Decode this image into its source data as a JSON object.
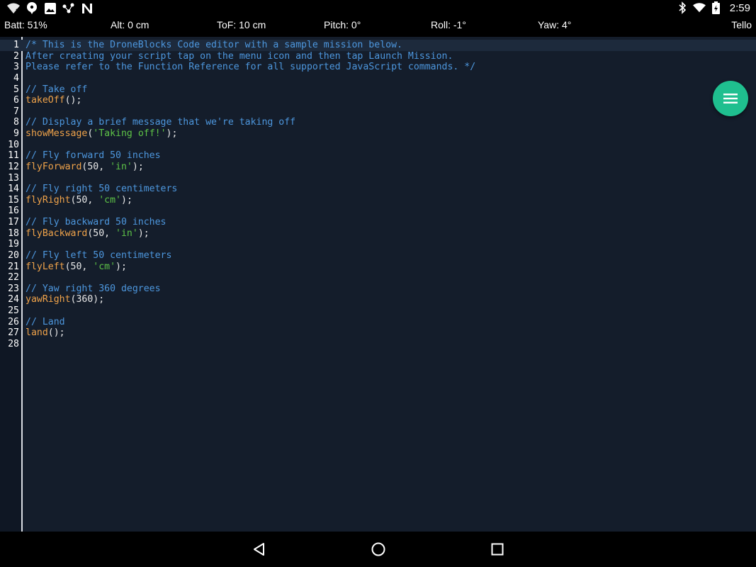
{
  "status_bar": {
    "left_icons": [
      "wifi-question-icon",
      "chat-bubble-icon",
      "image-icon",
      "dots-connect-icon",
      "n-logo-icon"
    ],
    "right_icons": [
      "bluetooth-icon",
      "wifi-icon",
      "battery-icon"
    ],
    "time": "2:59"
  },
  "telemetry": {
    "battery": "Batt: 51%",
    "altitude": "Alt: 0 cm",
    "tof": "ToF: 10 cm",
    "pitch": "Pitch: 0°",
    "roll": "Roll: -1°",
    "yaw": "Yaw: 4°",
    "drone": "Tello"
  },
  "colors": {
    "editor_bg": "#141d2b",
    "comment": "#4d97de",
    "function": "#f0a34a",
    "string": "#5ec447",
    "fab": "#1fbf8f"
  },
  "editor": {
    "active_line": 1,
    "lines": [
      {
        "n": "1",
        "tokens": [
          [
            "c",
            "/* This is the DroneBlocks Code editor with a sample mission below."
          ]
        ]
      },
      {
        "n": "2",
        "tokens": [
          [
            "c",
            "After creating your script tap on the menu icon and then tap Launch Mission."
          ]
        ]
      },
      {
        "n": "3",
        "tokens": [
          [
            "c",
            "Please refer to the Function Reference for all supported JavaScript commands. */"
          ]
        ]
      },
      {
        "n": "4",
        "tokens": []
      },
      {
        "n": "5",
        "tokens": [
          [
            "c",
            "// Take off"
          ]
        ]
      },
      {
        "n": "6",
        "tokens": [
          [
            "f",
            "takeOff"
          ],
          [
            "p",
            "();"
          ]
        ]
      },
      {
        "n": "7",
        "tokens": []
      },
      {
        "n": "8",
        "tokens": [
          [
            "c",
            "// Display a brief message that we're taking off"
          ]
        ]
      },
      {
        "n": "9",
        "tokens": [
          [
            "f",
            "showMessage"
          ],
          [
            "p",
            "("
          ],
          [
            "s",
            "'Taking off!'"
          ],
          [
            "p",
            ");"
          ]
        ]
      },
      {
        "n": "10",
        "tokens": []
      },
      {
        "n": "11",
        "tokens": [
          [
            "c",
            "// Fly forward 50 inches"
          ]
        ]
      },
      {
        "n": "12",
        "tokens": [
          [
            "f",
            "flyForward"
          ],
          [
            "p",
            "(50, "
          ],
          [
            "s",
            "'in'"
          ],
          [
            "p",
            ");"
          ]
        ]
      },
      {
        "n": "13",
        "tokens": []
      },
      {
        "n": "14",
        "tokens": [
          [
            "c",
            "// Fly right 50 centimeters"
          ]
        ]
      },
      {
        "n": "15",
        "tokens": [
          [
            "f",
            "flyRight"
          ],
          [
            "p",
            "(50, "
          ],
          [
            "s",
            "'cm'"
          ],
          [
            "p",
            ");"
          ]
        ]
      },
      {
        "n": "16",
        "tokens": []
      },
      {
        "n": "17",
        "tokens": [
          [
            "c",
            "// Fly backward 50 inches"
          ]
        ]
      },
      {
        "n": "18",
        "tokens": [
          [
            "f",
            "flyBackward"
          ],
          [
            "p",
            "(50, "
          ],
          [
            "s",
            "'in'"
          ],
          [
            "p",
            ");"
          ]
        ]
      },
      {
        "n": "19",
        "tokens": []
      },
      {
        "n": "20",
        "tokens": [
          [
            "c",
            "// Fly left 50 centimeters"
          ]
        ]
      },
      {
        "n": "21",
        "tokens": [
          [
            "f",
            "flyLeft"
          ],
          [
            "p",
            "(50, "
          ],
          [
            "s",
            "'cm'"
          ],
          [
            "p",
            ");"
          ]
        ]
      },
      {
        "n": "22",
        "tokens": []
      },
      {
        "n": "23",
        "tokens": [
          [
            "c",
            "// Yaw right 360 degrees"
          ]
        ]
      },
      {
        "n": "24",
        "tokens": [
          [
            "f",
            "yawRight"
          ],
          [
            "p",
            "(360);"
          ]
        ]
      },
      {
        "n": "25",
        "tokens": []
      },
      {
        "n": "26",
        "tokens": [
          [
            "c",
            "// Land"
          ]
        ]
      },
      {
        "n": "27",
        "tokens": [
          [
            "f",
            "land"
          ],
          [
            "p",
            "();"
          ]
        ]
      },
      {
        "n": "28",
        "tokens": []
      }
    ]
  },
  "fab": {
    "icon": "menu-icon"
  },
  "nav_bar": {
    "icons": [
      "back-icon",
      "home-icon",
      "recents-icon"
    ]
  }
}
